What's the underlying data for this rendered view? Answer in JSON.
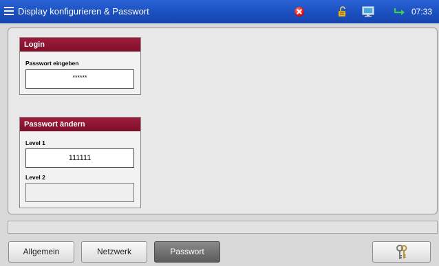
{
  "window": {
    "title": "Display konfigurieren & Passwort",
    "time": "07:33"
  },
  "icons": {
    "menu": "hamburger-menu-icon",
    "error": "error-x-icon",
    "lock": "lock-icon",
    "monitor": "monitor-icon",
    "arrow": "return-arrow-icon",
    "keys": "keys-icon"
  },
  "login": {
    "header": "Login",
    "label": "Passwort eingeben",
    "value": "******"
  },
  "change": {
    "header": "Passwort ändern",
    "level1_label": "Level 1",
    "level1_value": "111111",
    "level2_label": "Level 2",
    "level2_value": ""
  },
  "tabs": [
    "Allgemein",
    "Netzwerk",
    "Passwort"
  ],
  "active_tab": "Passwort",
  "colors": {
    "titlebar": "#1b4fbf",
    "group_header": "#8c1431",
    "active_tab": "#6e6e6e"
  }
}
